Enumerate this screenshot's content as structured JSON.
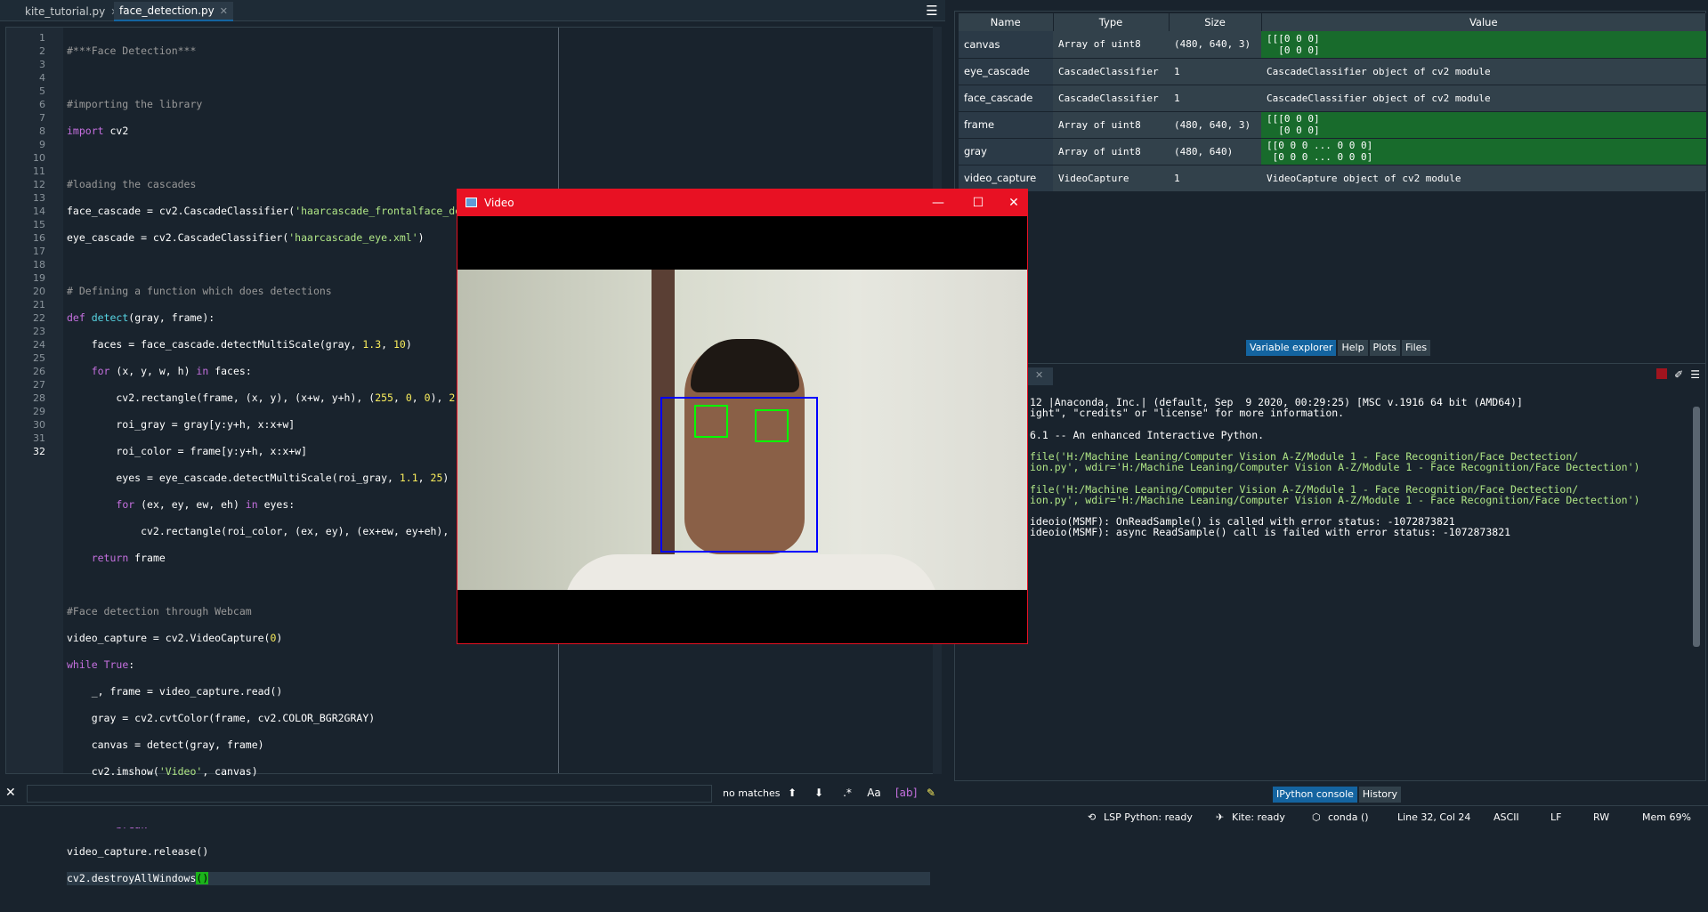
{
  "editor": {
    "tabs": [
      {
        "label": "kite_tutorial.py",
        "close": "✕"
      },
      {
        "label": "face_detection.py",
        "close": "✕"
      }
    ],
    "menu_icon": "hamburger-icon",
    "line_numbers": [
      "1",
      "2",
      "3",
      "4",
      "5",
      "6",
      "7",
      "8",
      "9",
      "10",
      "11",
      "12",
      "13",
      "14",
      "15",
      "16",
      "17",
      "18",
      "19",
      "20",
      "21",
      "22",
      "23",
      "24",
      "25",
      "26",
      "27",
      "28",
      "29",
      "30",
      "31",
      "32"
    ],
    "current_line": "32"
  },
  "find": {
    "value": "",
    "status": "no matches",
    "close": "✕"
  },
  "variables": {
    "headers": {
      "name": "Name",
      "type": "Type",
      "size": "Size",
      "value": "Value"
    },
    "rows": [
      {
        "name": "canvas",
        "type": "Array of uint8",
        "size": "(480, 640, 3)",
        "value": "[[[0 0 0]\n  [0 0 0]",
        "highlight": true
      },
      {
        "name": "eye_cascade",
        "type": "CascadeClassifier",
        "size": "1",
        "value": "CascadeClassifier object of cv2 module",
        "highlight": false
      },
      {
        "name": "face_cascade",
        "type": "CascadeClassifier",
        "size": "1",
        "value": "CascadeClassifier object of cv2 module",
        "highlight": false
      },
      {
        "name": "frame",
        "type": "Array of uint8",
        "size": "(480, 640, 3)",
        "value": "[[[0 0 0]\n  [0 0 0]",
        "highlight": true
      },
      {
        "name": "gray",
        "type": "Array of uint8",
        "size": "(480, 640)",
        "value": "[[0 0 0 ... 0 0 0]\n [0 0 0 ... 0 0 0]",
        "highlight": true
      },
      {
        "name": "video_capture",
        "type": "VideoCapture",
        "size": "1",
        "value": "VideoCapture object of cv2 module",
        "highlight": false
      }
    ],
    "tabs": [
      "Variable explorer",
      "Help",
      "Plots",
      "Files"
    ]
  },
  "console": {
    "lines": [
      {
        "text": "12 |Anaconda, Inc.| (default, Sep  9 2020, 00:29:25) [MSC v.1916 64 bit (AMD64)]",
        "kind": "plain"
      },
      {
        "text": "ight\", \"credits\" or \"license\" for more information.",
        "kind": "plain"
      },
      {
        "text": "",
        "kind": "plain"
      },
      {
        "text": "6.1 -- An enhanced Interactive Python.",
        "kind": "plain"
      },
      {
        "text": "",
        "kind": "plain"
      },
      {
        "text": "file('H:/Machine Leaning/Computer Vision A-Z/Module 1 - Face Recognition/Face Dectection/",
        "kind": "path"
      },
      {
        "text": "ion.py', wdir='H:/Machine Leaning/Computer Vision A-Z/Module 1 - Face Recognition/Face Dectection')",
        "kind": "path"
      },
      {
        "text": "",
        "kind": "plain"
      },
      {
        "text": "file('H:/Machine Leaning/Computer Vision A-Z/Module 1 - Face Recognition/Face Dectection/",
        "kind": "path"
      },
      {
        "text": "ion.py', wdir='H:/Machine Leaning/Computer Vision A-Z/Module 1 - Face Recognition/Face Dectection')",
        "kind": "path"
      },
      {
        "text": "",
        "kind": "plain"
      },
      {
        "text": "ideoio(MSMF): OnReadSample() is called with error status: -1072873821",
        "kind": "plain"
      },
      {
        "text": "ideoio(MSMF): async ReadSample() call is failed with error status: -1072873821",
        "kind": "plain"
      }
    ],
    "tabs": [
      "IPython console",
      "History"
    ]
  },
  "status": {
    "lsp": "LSP Python: ready",
    "kite": "Kite: ready",
    "conda": "conda ()",
    "position": "Line 32, Col 24",
    "encoding": "ASCII",
    "eol": "LF",
    "mode": "RW",
    "mem": "Mem 69%"
  },
  "video_window": {
    "title": "Video",
    "minimize": "—",
    "maximize": "☐",
    "close": "✕"
  },
  "colors": {
    "accent": "#1464a0",
    "video_title": "#e81123",
    "face_box": "#0000ff",
    "eye_box": "#00ff00",
    "var_highlight": "#186b2c"
  }
}
